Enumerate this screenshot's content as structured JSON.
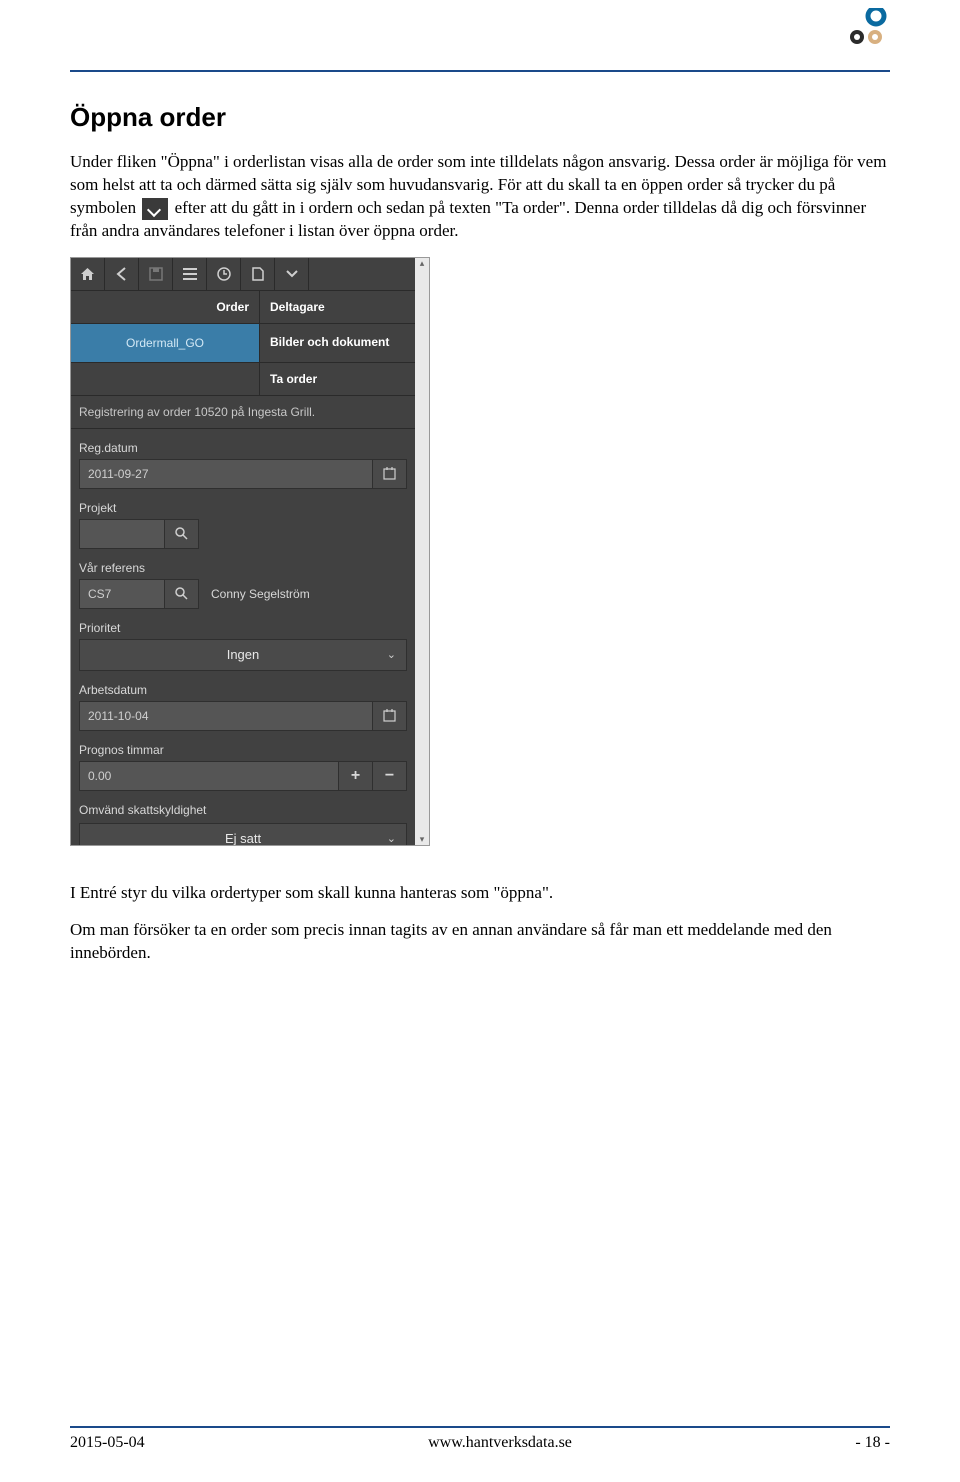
{
  "heading": "Öppna order",
  "para1_a": "Under fliken \"Öppna\" i orderlistan visas alla de order som inte tilldelats någon ansvarig. Dessa order är möjliga för vem som helst att ta och därmed sätta sig själv som huvudansvarig. För att du skall ta en öppen order så trycker du på symbolen ",
  "para1_b": " efter att du gått in i ordern och sedan på texten \"Ta order\". Denna order tilldelas då dig och försvinner från andra användares telefoner i listan över öppna order.",
  "para2": "I Entré styr du vilka ordertyper som skall kunna hanteras som \"öppna\".",
  "para3": "Om man försöker ta en order som precis innan tagits av en annan användare så får man ett meddelande med den innebörden.",
  "app": {
    "order_label": "Order",
    "menu": {
      "deltagare": "Deltagare",
      "bilder": "Bilder och dokument",
      "ta_order": "Ta order"
    },
    "tab_active": "Ordermall_GO",
    "status": "Registrering av order 10520 på Ingesta Grill.",
    "fields": {
      "regdatum_label": "Reg.datum",
      "regdatum_value": "2011-09-27",
      "projekt_label": "Projekt",
      "projekt_value": "",
      "ref_label": "Vår referens",
      "ref_code": "CS7",
      "ref_name": "Conny Segelström",
      "prio_label": "Prioritet",
      "prio_value": "Ingen",
      "arbdat_label": "Arbetsdatum",
      "arbdat_value": "2011-10-04",
      "prog_label": "Prognos timmar",
      "prog_value": "0.00",
      "omv_label": "Omvänd skattskyldighet",
      "omv_value": "Ej satt"
    }
  },
  "footer": {
    "date": "2015-05-04",
    "url": "www.hantverksdata.se",
    "page": "- 18 -"
  }
}
